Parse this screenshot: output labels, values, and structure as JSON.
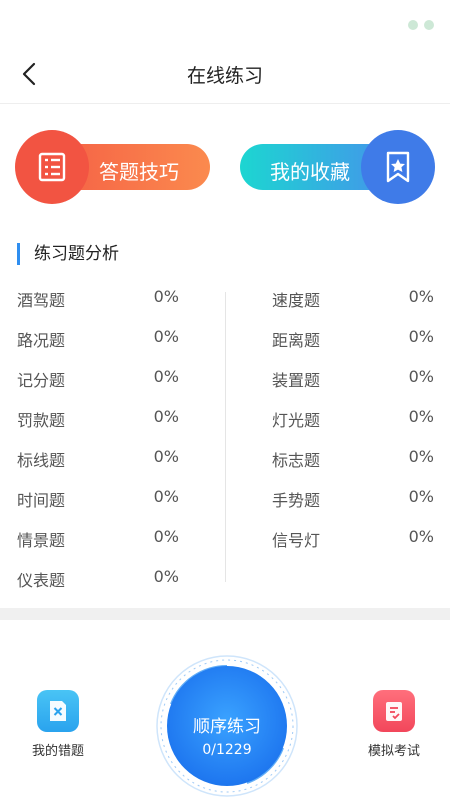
{
  "header": {
    "title": "在线练习"
  },
  "actions": {
    "tips_label": "答题技巧",
    "favorites_label": "我的收藏"
  },
  "analysis": {
    "title": "练习题分析",
    "left": [
      {
        "name": "酒驾题",
        "value": "0%"
      },
      {
        "name": "路况题",
        "value": "0%"
      },
      {
        "name": "记分题",
        "value": "0%"
      },
      {
        "name": "罚款题",
        "value": "0%"
      },
      {
        "name": "标线题",
        "value": "0%"
      },
      {
        "name": "时间题",
        "value": "0%"
      },
      {
        "name": "情景题",
        "value": "0%"
      },
      {
        "name": "仪表题",
        "value": "0%"
      }
    ],
    "right": [
      {
        "name": "速度题",
        "value": "0%"
      },
      {
        "name": "距离题",
        "value": "0%"
      },
      {
        "name": "装置题",
        "value": "0%"
      },
      {
        "name": "灯光题",
        "value": "0%"
      },
      {
        "name": "标志题",
        "value": "0%"
      },
      {
        "name": "手势题",
        "value": "0%"
      },
      {
        "name": "信号灯",
        "value": "0%"
      }
    ]
  },
  "bottom": {
    "wrong_label": "我的错题",
    "practice_label": "顺序练习",
    "practice_progress": "0/1229",
    "exam_label": "模拟考试"
  },
  "icons": {
    "back": "chevron-left-icon",
    "tips": "list-icon",
    "favorites": "bookmark-star-icon",
    "wrong": "document-x-icon",
    "exam": "clipboard-check-icon"
  }
}
